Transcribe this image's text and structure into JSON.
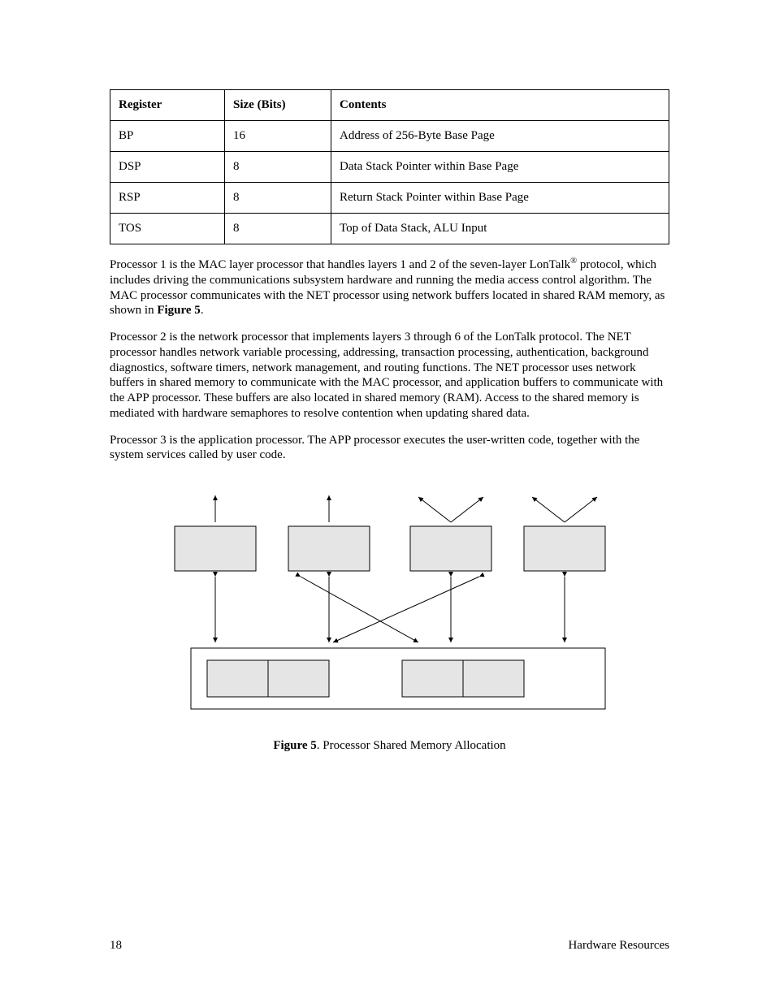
{
  "table": {
    "headers": [
      "Register",
      "Size (Bits)",
      "Contents"
    ],
    "rows": [
      {
        "reg": "BP",
        "size": "16",
        "contents": "Address of 256-Byte Base Page"
      },
      {
        "reg": "DSP",
        "size": "8",
        "contents": "Data Stack Pointer within Base Page"
      },
      {
        "reg": "RSP",
        "size": "8",
        "contents": "Return Stack Pointer within Base Page"
      },
      {
        "reg": "TOS",
        "size": "8",
        "contents": "Top of Data Stack, ALU Input"
      }
    ]
  },
  "para1_a": "Processor 1 is the MAC layer processor that handles layers 1 and 2 of the seven-layer LonTalk",
  "para1_b": " protocol, which includes driving the communications subsystem hardware and running the media access control algorithm.  The MAC processor communicates with the NET processor using network buffers located in shared RAM memory, as shown in ",
  "para1_fig": "Figure 5",
  "para1_c": ".",
  "reg_mark": "®",
  "para2": "Processor 2 is the network processor that implements layers 3 through 6 of the LonTalk protocol.  The NET processor handles network variable processing, addressing, transaction processing, authentication, background diagnostics, software timers, network management, and routing functions.  The NET processor uses network buffers in shared memory to communicate with the MAC processor, and application buffers to communicate with the APP processor.  These buffers are also located in shared memory (RAM).  Access to the shared memory is mediated with hardware semaphores to resolve contention when updating shared data.",
  "para3": "Processor 3 is the application processor.  The APP processor executes the user-written code, together with the system services called by user code.",
  "caption_bold": "Figure 5",
  "caption_rest": ". Processor Shared Memory Allocation",
  "footer_left": "18",
  "footer_right": "Hardware Resources"
}
